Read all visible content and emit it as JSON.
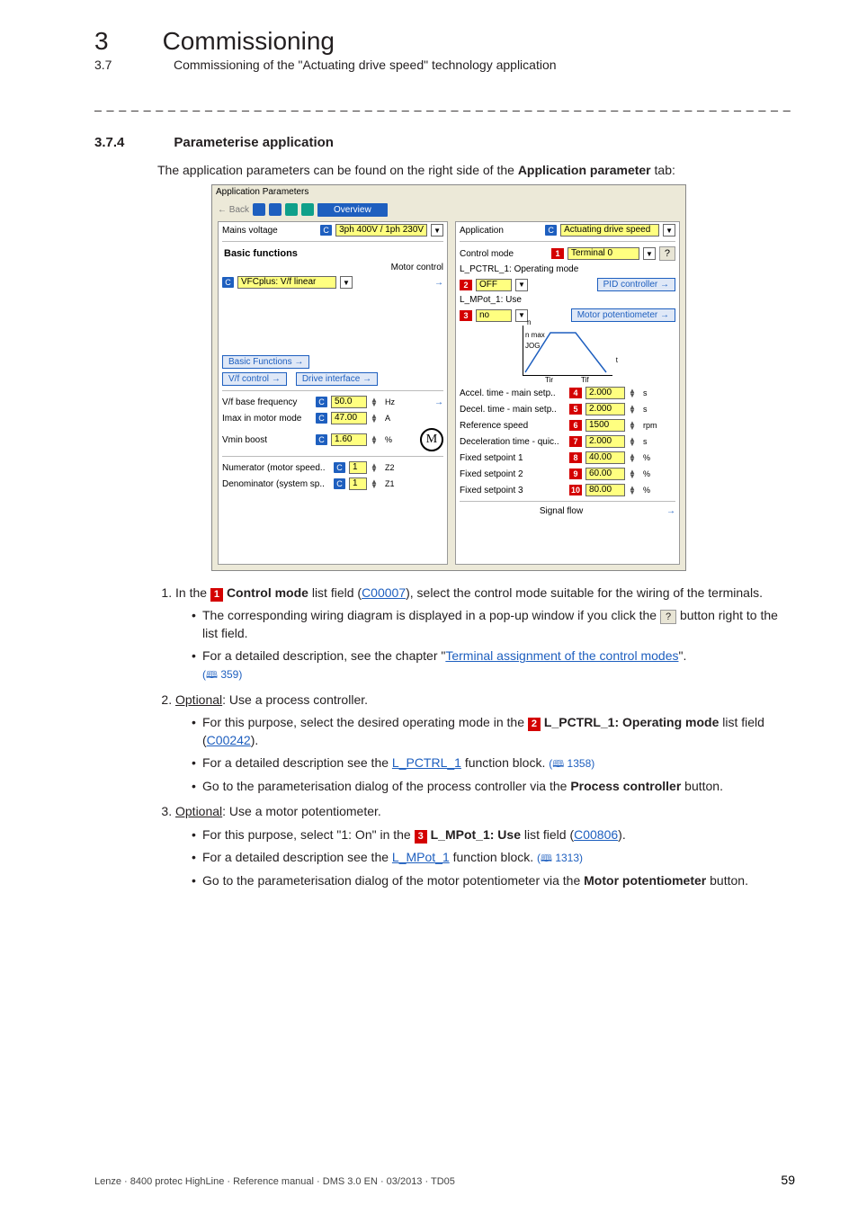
{
  "header": {
    "chapter_num": "3",
    "chapter_title": "Commissioning",
    "section_num": "3.7",
    "section_title": "Commissioning of the \"Actuating drive speed\" technology application"
  },
  "section": {
    "num": "3.7.4",
    "title": "Parameterise application",
    "intro_pre": "The application parameters can be found on the right side of the ",
    "intro_bold": "Application parameter",
    "intro_post": " tab:"
  },
  "shot": {
    "tab": "Application Parameters",
    "back": "← Back",
    "overview": "Overview",
    "left": {
      "mains_voltage_lbl": "Mains voltage",
      "mains_voltage_val": "3ph 400V / 1ph 230V",
      "basic_functions": "Basic functions",
      "motor_control_lbl": "Motor control",
      "motor_control_val": "VFCplus: V/f linear",
      "basic_functions_btn": "Basic Functions",
      "vf_control_btn": "V/f control",
      "drive_interface_btn": "Drive interface",
      "vf_base_freq_lbl": "V/f base frequency",
      "vf_base_freq_val": "50.0",
      "vf_base_freq_unit": "Hz",
      "imax_lbl": "Imax in motor mode",
      "imax_val": "47.00",
      "imax_unit": "A",
      "vmin_lbl": "Vmin boost",
      "vmin_val": "1.60",
      "vmin_unit": "%",
      "numerator_lbl": "Numerator (motor speed..",
      "numerator_val": "1",
      "numerator_unit": "Z2",
      "denominator_lbl": "Denominator (system sp..",
      "denominator_val": "1",
      "denominator_unit": "Z1",
      "motor_glyph": "M"
    },
    "right": {
      "application_lbl": "Application",
      "application_val": "Actuating drive speed",
      "control_mode_lbl": "Control mode",
      "control_mode_val": "Terminal 0",
      "lpctrl_lbl": "L_PCTRL_1: Operating mode",
      "lpctrl_val": "OFF",
      "pid_btn": "PID controller",
      "lmpot_lbl": "L_MPot_1: Use",
      "lmpot_val": "no",
      "mpot_btn": "Motor potentiometer",
      "chart_n": "n",
      "chart_nmax": "n max",
      "chart_jog": "JOG",
      "chart_tir": "Tir",
      "chart_tif": "Tif",
      "chart_t": "t",
      "rows": [
        {
          "tag": "4",
          "lbl": "Accel. time - main setp..",
          "val": "2.000",
          "unit": "s"
        },
        {
          "tag": "5",
          "lbl": "Decel. time - main setp..",
          "val": "2.000",
          "unit": "s"
        },
        {
          "tag": "6",
          "lbl": "Reference speed",
          "val": "1500",
          "unit": "rpm"
        },
        {
          "tag": "7",
          "lbl": "Deceleration time - quic..",
          "val": "2.000",
          "unit": "s"
        },
        {
          "tag": "8",
          "lbl": "Fixed setpoint 1",
          "val": "40.00",
          "unit": "%"
        },
        {
          "tag": "9",
          "lbl": "Fixed setpoint 2",
          "val": "60.00",
          "unit": "%"
        },
        {
          "tag": "10",
          "lbl": "Fixed setpoint 3",
          "val": "80.00",
          "unit": "%"
        }
      ],
      "signal_flow": "Signal flow"
    }
  },
  "steps": {
    "s1_a": "In the ",
    "s1_b": " list field (",
    "s1_code": "C00007",
    "s1_c": "), select the control mode suitable for the wiring of the terminals.",
    "s1_bold": "Control mode",
    "s1_sub1_a": "The corresponding wiring diagram is displayed in a pop-up window if you click the ",
    "s1_sub1_q": "?",
    "s1_sub1_b": " button right to the list field.",
    "s1_sub2_a": "For a detailed description, see the chapter \"",
    "s1_sub2_link": "Terminal assignment of the control modes",
    "s1_sub2_b": "\".",
    "s1_sub2_x": " 359)",
    "s2_lead_u": "Optional",
    "s2_lead": ": Use a process controller.",
    "s2_sub1_a": "For this purpose, select the desired operating mode in the ",
    "s2_sub1_bold": "L_PCTRL_1: Operating mode",
    "s2_sub1_b": " list field (",
    "s2_sub1_code": "C00242",
    "s2_sub1_c": ").",
    "s2_sub2_a": "For a detailed description see the ",
    "s2_sub2_link": "L_PCTRL_1",
    "s2_sub2_b": " function block. ",
    "s2_sub2_x": " 1358)",
    "s2_sub3_a": "Go to the parameterisation dialog of the process controller via the ",
    "s2_sub3_bold": "Process controller",
    "s2_sub3_b": " button.",
    "s3_lead_u": "Optional",
    "s3_lead": ": Use a motor potentiometer.",
    "s3_sub1_a": "For this purpose, select \"1: On\" in the ",
    "s3_sub1_bold": "L_MPot_1: Use",
    "s3_sub1_b": " list field (",
    "s3_sub1_code": "C00806",
    "s3_sub1_c": ").",
    "s3_sub2_a": "For a detailed description see the ",
    "s3_sub2_link": "L_MPot_1",
    "s3_sub2_b": " function block. ",
    "s3_sub2_x": " 1313)",
    "s3_sub3_a": "Go to the parameterisation dialog of the motor potentiometer via the ",
    "s3_sub3_bold": "Motor potentiometer",
    "s3_sub3_b": " button."
  },
  "footer": {
    "left": "Lenze · 8400 protec HighLine · Reference manual · DMS 3.0 EN · 03/2013 · TD05",
    "page": "59"
  }
}
